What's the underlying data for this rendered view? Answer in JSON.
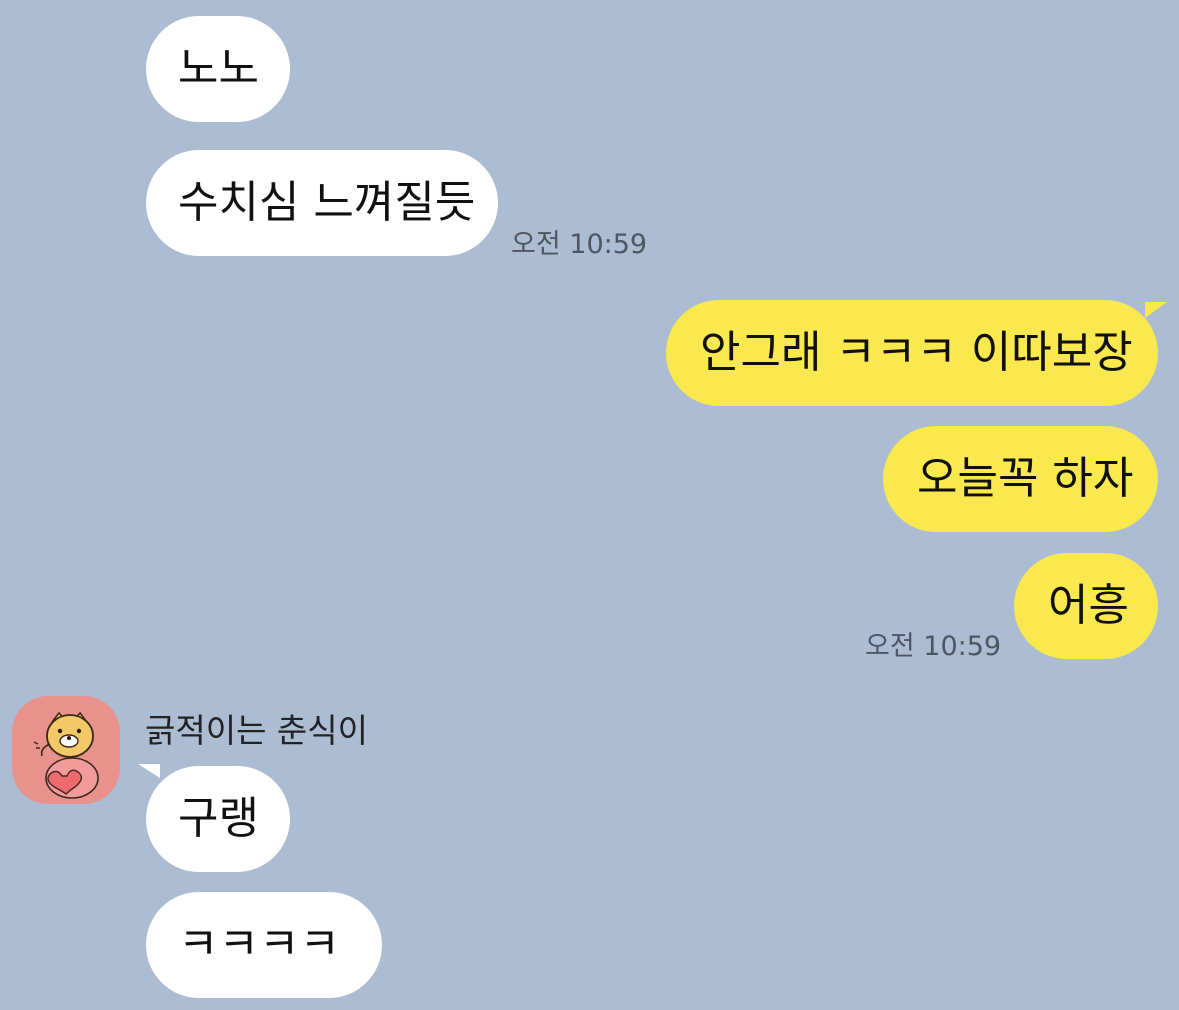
{
  "chat": {
    "messages": [
      {
        "side": "in",
        "text": "노노"
      },
      {
        "side": "in",
        "text": "수치심 느껴질듯",
        "time": "오전 10:59"
      },
      {
        "side": "out",
        "text": "안그래 ㅋㅋㅋ 이따보장"
      },
      {
        "side": "out",
        "text": "오늘꼭 하자"
      },
      {
        "side": "out",
        "text": "어흥",
        "time": "오전 10:59"
      },
      {
        "side": "in",
        "sender": "긁적이는 춘식이",
        "text": "구랭"
      },
      {
        "side": "in",
        "text": "ㅋㅋㅋㅋ"
      }
    ]
  },
  "avatar": {
    "icon": "chunsik-cat-character-icon",
    "background_color": "#e9918d"
  },
  "colors": {
    "background": "#acbdd3",
    "incoming_bubble": "#ffffff",
    "outgoing_bubble": "#f9e84e"
  }
}
